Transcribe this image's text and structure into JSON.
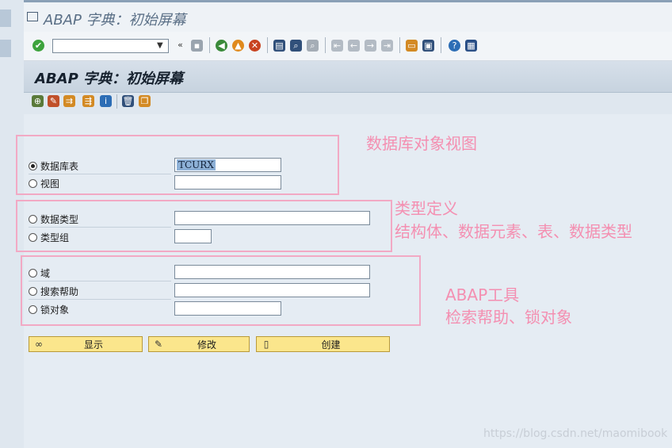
{
  "window": {
    "title": "ABAP 字典：初始屏幕"
  },
  "screen": {
    "title": "ABAP 字典：初始屏幕"
  },
  "toolbar": {
    "command_value": "",
    "icons": [
      "check-icon",
      "back-arrows-icon",
      "save-icon",
      "back-icon",
      "exit-icon",
      "cancel-icon",
      "print-icon",
      "find-icon",
      "find-next-icon",
      "first-page-icon",
      "prev-page-icon",
      "next-page-icon",
      "last-page-icon",
      "new-session-icon",
      "shortcut-icon",
      "help-icon",
      "settings-icon"
    ]
  },
  "app_toolbar": {
    "icons": [
      "other-object-icon",
      "edit-icon",
      "copy-icon",
      "where-used-icon",
      "info-icon",
      "delete-icon",
      "copy-object-icon"
    ]
  },
  "options": {
    "db_table": {
      "label": "数据库表",
      "value": "TCURX",
      "selected": true
    },
    "view": {
      "label": "视图",
      "value": ""
    },
    "data_type": {
      "label": "数据类型",
      "value": ""
    },
    "type_group": {
      "label": "类型组",
      "value": ""
    },
    "domain": {
      "label": "域",
      "value": ""
    },
    "search_help": {
      "label": "搜索帮助",
      "value": ""
    },
    "lock_object": {
      "label": "锁对象",
      "value": ""
    }
  },
  "buttons": {
    "display": "显示",
    "change": "修改",
    "create": "创建"
  },
  "annotations": {
    "group1": "数据库对象视图",
    "group2_line1": "类型定义",
    "group2_line2": "结构体、数据元素、表、数据类型",
    "group3_line1": "ABAP工具",
    "group3_line2": "检索帮助、锁对象"
  },
  "watermark": "https://blog.csdn.net/maomibook",
  "colors": {
    "annotation": "#f48fb1",
    "button": "#fbe68c",
    "header": "#c7d3df"
  }
}
